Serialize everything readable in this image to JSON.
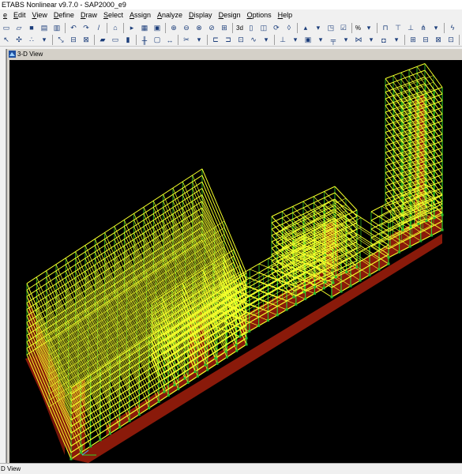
{
  "app": {
    "title": "ETABS Nonlinear v9.7.0 - SAP2000_e9"
  },
  "menu": [
    {
      "id": "file",
      "label": "e"
    },
    {
      "id": "edit",
      "label": "Edit"
    },
    {
      "id": "view",
      "label": "View"
    },
    {
      "id": "define",
      "label": "Define"
    },
    {
      "id": "draw",
      "label": "Draw"
    },
    {
      "id": "select",
      "label": "Select"
    },
    {
      "id": "assign",
      "label": "Assign"
    },
    {
      "id": "analyze",
      "label": "Analyze"
    },
    {
      "id": "display",
      "label": "Display"
    },
    {
      "id": "design",
      "label": "Design"
    },
    {
      "id": "options",
      "label": "Options"
    },
    {
      "id": "help",
      "label": "Help"
    }
  ],
  "toolbar": {
    "view3d_label": "3d",
    "units_label": "%"
  },
  "view": {
    "title": "3-D View"
  },
  "statusbar": {
    "text": "D View"
  },
  "colors": {
    "background": "#000000",
    "beam": "#f5ff2a",
    "column": "#33d62b",
    "wall": "#8a1a0a",
    "joint": "#2fbf2f"
  },
  "icons": {
    "view": "3d-view-icon"
  }
}
